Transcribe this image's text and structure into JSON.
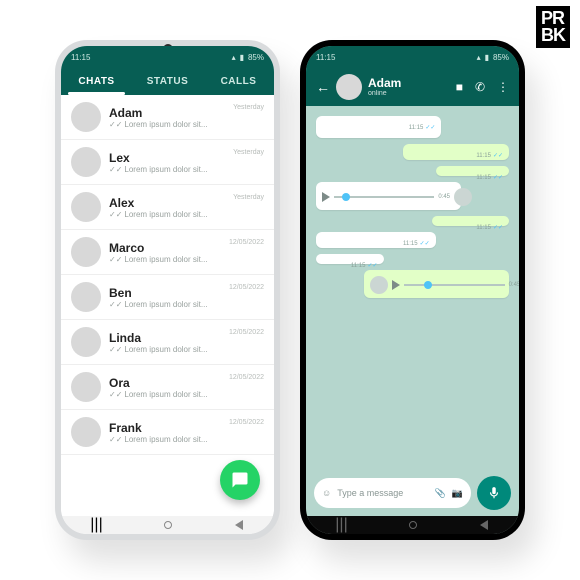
{
  "watermark": {
    "line1": "PR",
    "line2": "BK"
  },
  "statusbar": {
    "time": "11:15",
    "battery": "85%"
  },
  "colors": {
    "primary": "#075e54",
    "fab": "#25d366",
    "mic": "#00897b",
    "tick": "#4fc3f7"
  },
  "tabs": {
    "chats": "CHATS",
    "status": "STATUS",
    "calls": "CALLS",
    "active": "chats"
  },
  "preview_text": "Lorem ipsum dolor sit...",
  "contacts": [
    {
      "name": "Adam",
      "ts": "Yesterday"
    },
    {
      "name": "Lex",
      "ts": "Yesterday"
    },
    {
      "name": "Alex",
      "ts": "Yesterday"
    },
    {
      "name": "Marco",
      "ts": "12/05/2022"
    },
    {
      "name": "Ben",
      "ts": "12/05/2022"
    },
    {
      "name": "Linda",
      "ts": "12/05/2022"
    },
    {
      "name": "Ora",
      "ts": "12/05/2022"
    },
    {
      "name": "Frank",
      "ts": "12/05/2022"
    }
  ],
  "chat": {
    "name": "Adam",
    "status": "online",
    "input_placeholder": "Type a message",
    "voice_time": "0:45",
    "msg_time": "11:15"
  }
}
